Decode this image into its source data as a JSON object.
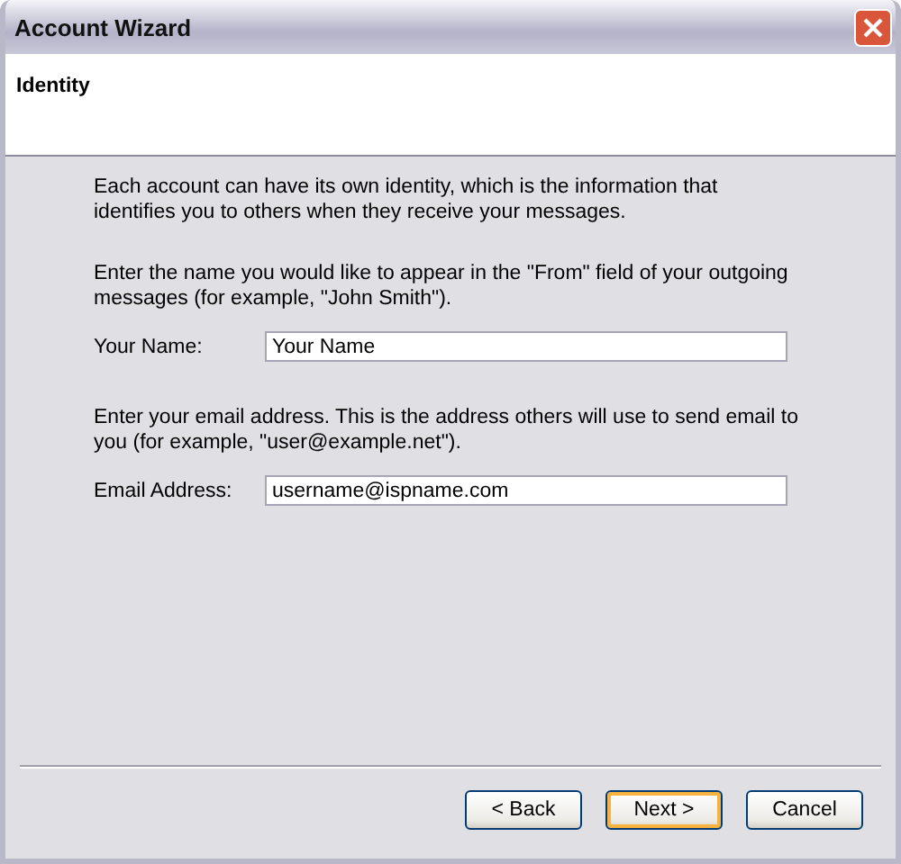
{
  "window": {
    "title": "Account Wizard"
  },
  "header": {
    "title": "Identity"
  },
  "paragraphs": [
    "Each account can have its own identity, which is the information that identifies you to others when they receive your messages."
  ],
  "sections": [
    {
      "text": "Enter the name you would like to appear in the \"From\" field of your outgoing messages (for example, \"John Smith\").",
      "label": "Your Name:",
      "value": "Your Name"
    },
    {
      "text": "Enter your email address. This is the address others will use to send email to you (for example, \"user@example.net\").",
      "label": "Email Address:",
      "value": "username@ispname.com"
    }
  ],
  "buttons": [
    {
      "label": "< Back",
      "default": false
    },
    {
      "label": "Next >",
      "default": true
    },
    {
      "label": "Cancel",
      "default": false
    }
  ]
}
